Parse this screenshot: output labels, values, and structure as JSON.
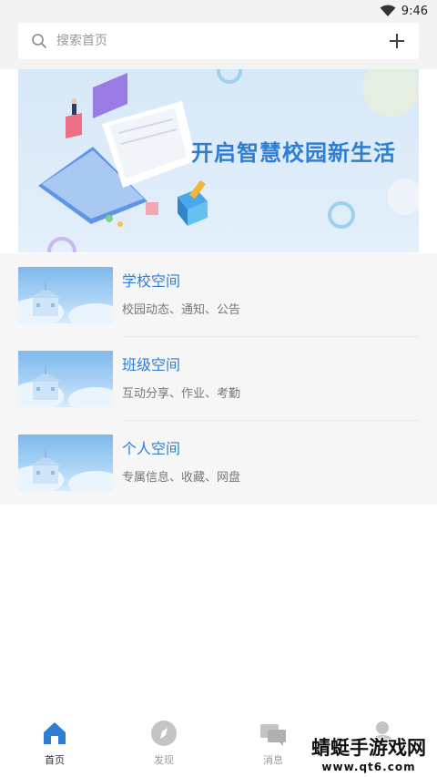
{
  "status_bar": {
    "time": "9:46",
    "wifi_icon": "wifi-icon"
  },
  "search": {
    "placeholder": "搜索首页",
    "search_icon": "search-icon",
    "add_icon": "plus-icon"
  },
  "banner": {
    "title": "开启智慧校园新生活"
  },
  "list": {
    "items": [
      {
        "title": "学校空间",
        "desc": "校园动态、通知、公告"
      },
      {
        "title": "班级空间",
        "desc": "互动分享、作业、考勤"
      },
      {
        "title": "个人空间",
        "desc": "专属信息、收藏、网盘"
      }
    ]
  },
  "tabbar": {
    "tabs": [
      {
        "label": "首页",
        "icon": "home-icon",
        "active": true
      },
      {
        "label": "发现",
        "icon": "compass-icon",
        "active": false
      },
      {
        "label": "消息",
        "icon": "message-icon",
        "active": false
      },
      {
        "label": "",
        "icon": "profile-icon",
        "active": false
      }
    ]
  },
  "watermark": {
    "main": "蜻蜓手游戏网",
    "url": "www.qt6.com"
  },
  "colors": {
    "accent": "#2e7ed6",
    "tab_active": "#2e7ed6",
    "tab_inactive": "#bdbdbd"
  }
}
